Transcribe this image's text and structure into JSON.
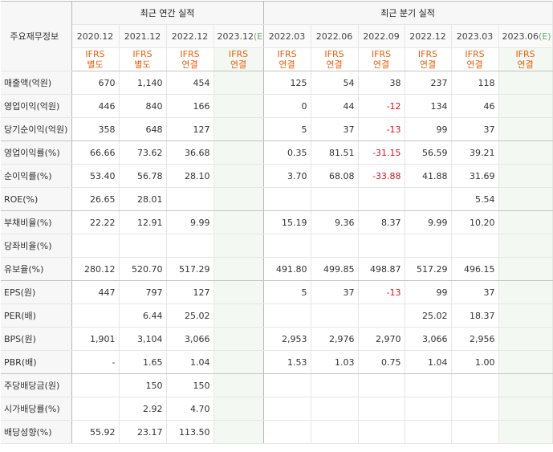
{
  "header": {
    "main_label": "주요재무정보",
    "annual_title": "최근 연간 실적",
    "quarter_title": "최근 분기 실적",
    "columns": [
      {
        "period": "2020.12",
        "estimate": false,
        "std": "IFRS",
        "basis": "별도"
      },
      {
        "period": "2021.12",
        "estimate": false,
        "std": "IFRS",
        "basis": "별도"
      },
      {
        "period": "2022.12",
        "estimate": false,
        "std": "IFRS",
        "basis": "연결"
      },
      {
        "period": "2023.12",
        "estimate": true,
        "est_mark": "(E)",
        "std": "IFRS",
        "basis": "연결"
      },
      {
        "period": "2022.03",
        "estimate": false,
        "std": "IFRS",
        "basis": "연결"
      },
      {
        "period": "2022.06",
        "estimate": false,
        "std": "IFRS",
        "basis": "연결"
      },
      {
        "period": "2022.09",
        "estimate": false,
        "std": "IFRS",
        "basis": "연결"
      },
      {
        "period": "2022.12",
        "estimate": false,
        "std": "IFRS",
        "basis": "연결"
      },
      {
        "period": "2023.03",
        "estimate": false,
        "std": "IFRS",
        "basis": "연결"
      },
      {
        "period": "2023.06",
        "estimate": true,
        "est_mark": "(E)",
        "std": "IFRS",
        "basis": "연결"
      }
    ]
  },
  "rows": [
    {
      "label": "매출액(억원)",
      "values": [
        "670",
        "1,140",
        "454",
        "",
        "125",
        "54",
        "38",
        "237",
        "118",
        ""
      ]
    },
    {
      "label": "영업이익(억원)",
      "values": [
        "446",
        "840",
        "166",
        "",
        "0",
        "44",
        "-12",
        "134",
        "46",
        ""
      ]
    },
    {
      "label": "당기순이익(억원)",
      "values": [
        "358",
        "648",
        "127",
        "",
        "5",
        "37",
        "-13",
        "99",
        "37",
        ""
      ]
    },
    {
      "label": "영업이익률(%)",
      "values": [
        "66.66",
        "73.62",
        "36.68",
        "",
        "0.35",
        "81.51",
        "-31.15",
        "56.59",
        "39.21",
        ""
      ]
    },
    {
      "label": "순이익률(%)",
      "values": [
        "53.40",
        "56.78",
        "28.10",
        "",
        "3.70",
        "68.08",
        "-33.88",
        "41.88",
        "31.69",
        ""
      ]
    },
    {
      "label": "ROE(%)",
      "values": [
        "26.65",
        "28.01",
        "",
        "",
        "",
        "",
        "",
        "",
        "5.54",
        ""
      ]
    },
    {
      "label": "부채비율(%)",
      "values": [
        "22.22",
        "12.91",
        "9.99",
        "",
        "15.19",
        "9.36",
        "8.37",
        "9.99",
        "10.20",
        ""
      ]
    },
    {
      "label": "당좌비율(%)",
      "values": [
        "",
        "",
        "",
        "",
        "",
        "",
        "",
        "",
        "",
        ""
      ]
    },
    {
      "label": "유보율(%)",
      "values": [
        "280.12",
        "520.70",
        "517.29",
        "",
        "491.80",
        "499.85",
        "498.87",
        "517.29",
        "496.15",
        ""
      ]
    },
    {
      "label": "EPS(원)",
      "values": [
        "447",
        "797",
        "127",
        "",
        "5",
        "37",
        "-13",
        "99",
        "37",
        ""
      ]
    },
    {
      "label": "PER(배)",
      "values": [
        "",
        "6.44",
        "25.02",
        "",
        "",
        "",
        "",
        "25.02",
        "18.37",
        ""
      ]
    },
    {
      "label": "BPS(원)",
      "values": [
        "1,901",
        "3,104",
        "3,066",
        "",
        "2,953",
        "2,976",
        "2,970",
        "3,066",
        "2,956",
        ""
      ]
    },
    {
      "label": "PBR(배)",
      "values": [
        "-",
        "1.65",
        "1.04",
        "",
        "1.53",
        "1.03",
        "0.75",
        "1.04",
        "1.00",
        ""
      ]
    },
    {
      "label": "주당배당금(원)",
      "values": [
        "",
        "150",
        "150",
        "",
        "",
        "",
        "",
        "",
        "",
        ""
      ]
    },
    {
      "label": "시가배당률(%)",
      "values": [
        "",
        "2.92",
        "4.70",
        "",
        "",
        "",
        "",
        "",
        "",
        ""
      ]
    },
    {
      "label": "배당성향(%)",
      "values": [
        "55.92",
        "23.17",
        "113.50",
        "",
        "",
        "",
        "",
        "",
        "",
        ""
      ]
    }
  ],
  "colors": {
    "ifrs": "#e8600c",
    "negative": "#e4101c",
    "estimate_bg": "#f3f9f2"
  }
}
